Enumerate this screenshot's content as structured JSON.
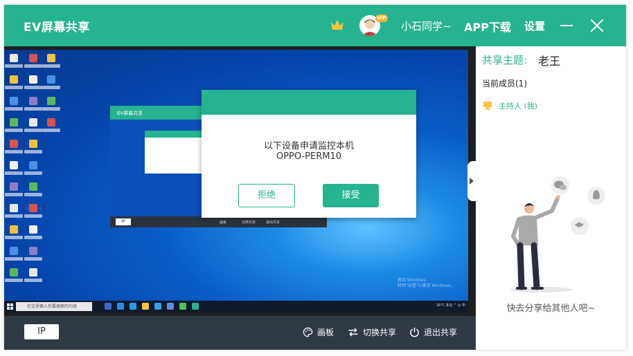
{
  "titlebar": {
    "app_title": "EV屏幕共享",
    "vip_badge": "VIP",
    "username": "小石同学~",
    "app_download": "APP下载",
    "settings": "设置",
    "crown_icon": "crown-icon",
    "minimize_icon": "minimize-icon",
    "close_icon": "close-icon"
  },
  "remote_screen": {
    "inner_window_title": "EV屏幕共享",
    "inner_ip": "IP",
    "inner_toolbar": [
      "画板",
      "切换共享",
      "退出共享"
    ],
    "taskbar_search": "在这里输入你要搜索的内容",
    "taskbar_tray": "16°C 多云  ^  ◎ 中",
    "activate_windows": [
      "激活 Windows",
      "转到\"设置\"以激活 Windows。"
    ]
  },
  "dialog": {
    "line1": "以下设备申请监控本机",
    "line2": "OPPO-PERM10",
    "reject": "拒绝",
    "accept": "接受"
  },
  "bottombar": {
    "ip": "IP",
    "draw_board": "画板",
    "switch_share": "切换共享",
    "exit_share": "退出共享"
  },
  "panel": {
    "topic_label": "共享主题:",
    "topic_value": "老王",
    "members": "当前成员(1)",
    "host": "主持人 (我)",
    "share_prompt": "快去分享给其他人吧~",
    "social_icons": [
      "wechat-icon",
      "qq-icon",
      "twitter-icon"
    ]
  },
  "colors": {
    "brand": "#26b38f",
    "bottombar": "#2f3a45",
    "desktop": "#0a5cc8"
  }
}
